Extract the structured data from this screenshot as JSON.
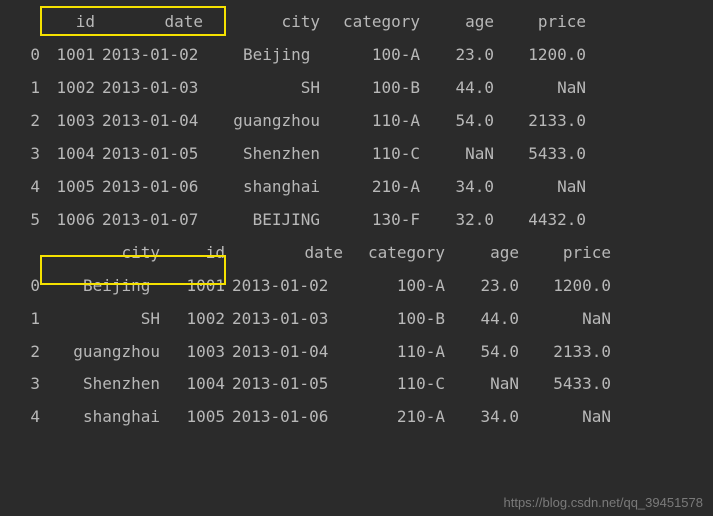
{
  "chart_data": [
    {
      "type": "table",
      "columns": [
        "id",
        "date",
        "city",
        "category",
        "age",
        "price"
      ],
      "index": [
        "0",
        "1",
        "2",
        "3",
        "4",
        "5"
      ],
      "rows": [
        {
          "id": "1001",
          "date": "2013-01-02",
          "city": "Beijing ",
          "category": "100-A",
          "age": "23.0",
          "price": "1200.0"
        },
        {
          "id": "1002",
          "date": "2013-01-03",
          "city": "SH",
          "category": "100-B",
          "age": "44.0",
          "price": "NaN"
        },
        {
          "id": "1003",
          "date": "2013-01-04",
          "city": "guangzhou",
          "category": "110-A",
          "age": "54.0",
          "price": "2133.0"
        },
        {
          "id": "1004",
          "date": "2013-01-05",
          "city": "Shenzhen",
          "category": "110-C",
          "age": "NaN",
          "price": "5433.0"
        },
        {
          "id": "1005",
          "date": "2013-01-06",
          "city": "shanghai",
          "category": "210-A",
          "age": "34.0",
          "price": "NaN"
        },
        {
          "id": "1006",
          "date": "2013-01-07",
          "city": "BEIJING",
          "category": "130-F",
          "age": "32.0",
          "price": "4432.0"
        }
      ]
    },
    {
      "type": "table",
      "columns": [
        "city",
        "id",
        "date",
        "category",
        "age",
        "price"
      ],
      "index": [
        "0",
        "1",
        "2",
        "3",
        "4"
      ],
      "rows": [
        {
          "city": "Beijing ",
          "id": "1001",
          "date": "2013-01-02",
          "category": "100-A",
          "age": "23.0",
          "price": "1200.0"
        },
        {
          "city": "SH",
          "id": "1002",
          "date": "2013-01-03",
          "category": "100-B",
          "age": "44.0",
          "price": "NaN"
        },
        {
          "city": "guangzhou",
          "id": "1003",
          "date": "2013-01-04",
          "category": "110-A",
          "age": "54.0",
          "price": "2133.0"
        },
        {
          "city": "Shenzhen",
          "id": "1004",
          "date": "2013-01-05",
          "category": "110-C",
          "age": "NaN",
          "price": "5433.0"
        },
        {
          "city": "shanghai",
          "id": "1005",
          "date": "2013-01-06",
          "category": "210-A",
          "age": "34.0",
          "price": "NaN"
        }
      ]
    }
  ],
  "watermark": "https://blog.csdn.net/qq_39451578"
}
